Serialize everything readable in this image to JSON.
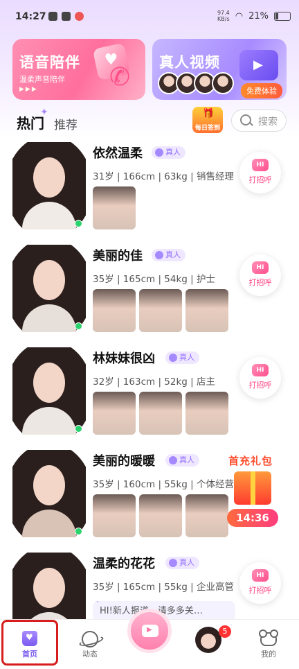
{
  "status_bar": {
    "time": "14:27",
    "net_speed_value": "97.4",
    "net_speed_unit": "KB/s",
    "battery": "21%"
  },
  "banners": {
    "voice": {
      "title": "语音陪伴",
      "subtitle": "温柔声音陪伴",
      "dots": "▶▶▶"
    },
    "video": {
      "title": "真人视频",
      "button": "免费体验"
    }
  },
  "tabs": {
    "hot": "热门",
    "recommend": "推荐"
  },
  "checkin": {
    "label": "每日签到"
  },
  "search": {
    "placeholder": "搜索"
  },
  "verify_label": "真人",
  "greet_label": "打招呼",
  "greet_badge": "HI",
  "users": [
    {
      "name": "依然温柔",
      "info": "31岁 | 166cm | 63kg | 销售经理",
      "online": true,
      "thumb_count": 1
    },
    {
      "name": "美丽的佳",
      "info": "35岁 | 165cm | 54kg | 护士",
      "online": true,
      "thumb_count": 3
    },
    {
      "name": "林妹妹很凶",
      "info": "32岁 | 163cm | 52kg | 店主",
      "online": true,
      "thumb_count": 3
    },
    {
      "name": "美丽的暖暖",
      "info": "35岁 | 160cm | 55kg | 个体经营",
      "online": true,
      "thumb_count": 3
    },
    {
      "name": "温柔的花花",
      "info": "35岁 | 165cm | 55kg | 企业高管",
      "online": false,
      "quote": "HI!新人报道，请多多关…"
    }
  ],
  "promo": {
    "title": "首充礼包",
    "timer": "14:36"
  },
  "nav": {
    "home": "首页",
    "moments": "动态",
    "messages_badge": "5",
    "me": "我的"
  },
  "colors": {
    "accent": "#7a5bf0",
    "pink": "#ff4f8d",
    "highlight": "#d71d1d"
  }
}
